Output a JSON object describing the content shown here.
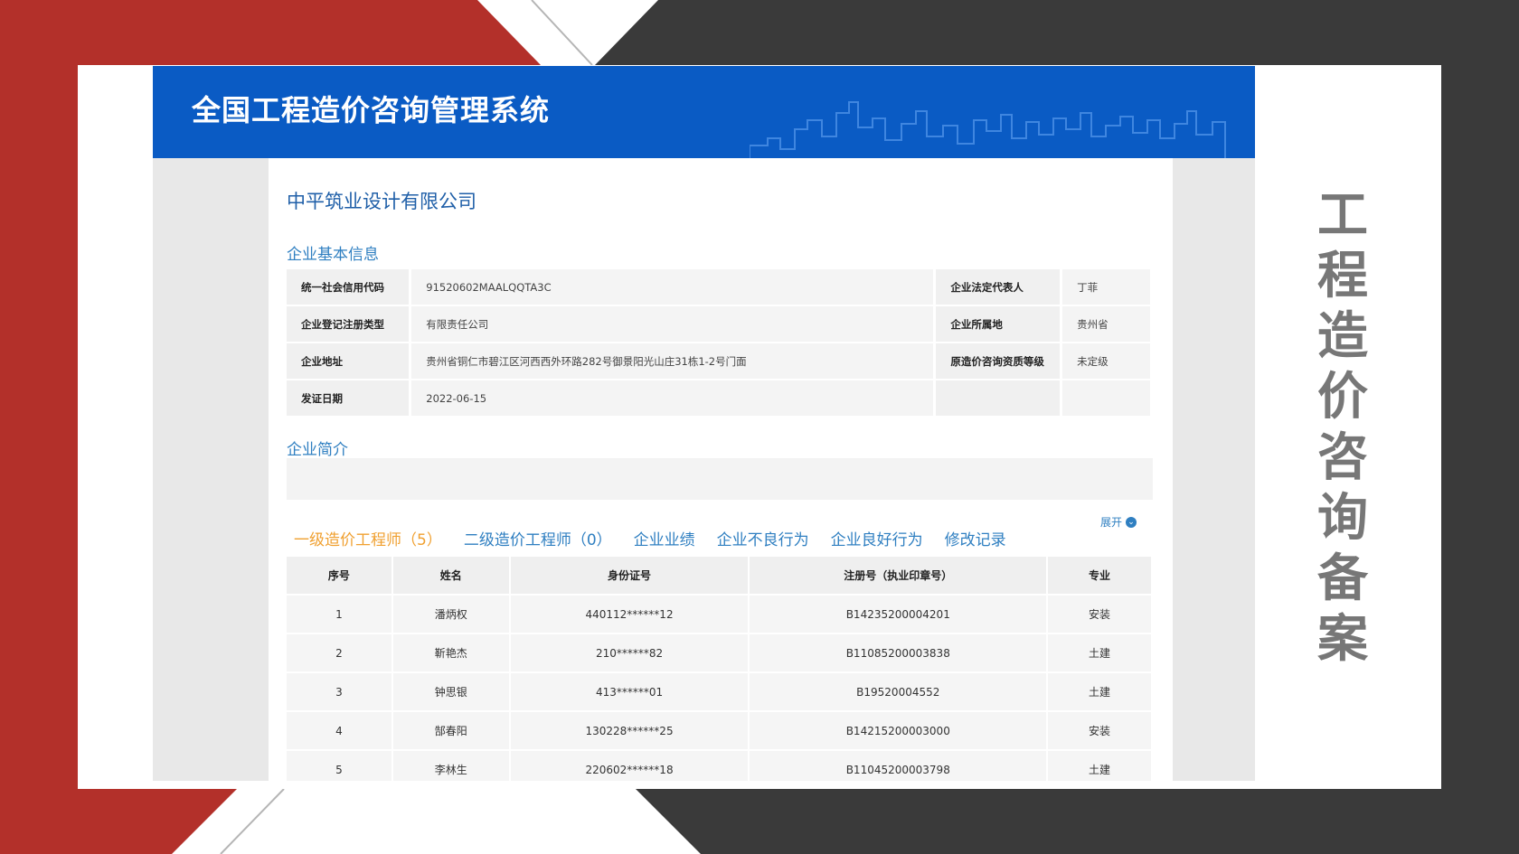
{
  "colors": {
    "red": "#b3302a",
    "dark": "#3a3a3a",
    "header_blue": "#0a5bc4",
    "link_blue": "#2f7fc1",
    "active_orange": "#f0a030",
    "vertical_title_gray": "#777777"
  },
  "header": {
    "system_title": "全国工程造价咨询管理系统"
  },
  "company": {
    "name": "中平筑业设计有限公司"
  },
  "sections": {
    "basic_info": "企业基本信息",
    "intro": "企业简介",
    "expand_label": "展开",
    "expand_icon": "chevron-down-circle-icon"
  },
  "basic_info": {
    "rows": [
      {
        "label1": "统一社会信用代码",
        "value1": "91520602MAALQQTA3C",
        "label2": "企业法定代表人",
        "value2": "丁菲"
      },
      {
        "label1": "企业登记注册类型",
        "value1": "有限责任公司",
        "label2": "企业所属地",
        "value2": "贵州省"
      },
      {
        "label1": "企业地址",
        "value1": "贵州省铜仁市碧江区河西西外环路282号御景阳光山庄31栋1-2号门面",
        "label2": "原造价咨询资质等级",
        "value2": "未定级"
      },
      {
        "label1": "发证日期",
        "value1": "2022-06-15",
        "label2": "",
        "value2": ""
      }
    ]
  },
  "tabs": [
    {
      "label": "一级造价工程师（5）",
      "active": true
    },
    {
      "label": "二级造价工程师（0）",
      "active": false
    },
    {
      "label": "企业业绩",
      "active": false
    },
    {
      "label": "企业不良行为",
      "active": false
    },
    {
      "label": "企业良好行为",
      "active": false
    },
    {
      "label": "修改记录",
      "active": false
    }
  ],
  "engineers": {
    "headers": [
      "序号",
      "姓名",
      "身份证号",
      "注册号（执业印章号）",
      "专业"
    ],
    "rows": [
      [
        "1",
        "潘炳权",
        "440112******12",
        "B14235200004201",
        "安装"
      ],
      [
        "2",
        "靳艳杰",
        "210******82",
        "B11085200003838",
        "土建"
      ],
      [
        "3",
        "钟思银",
        "413******01",
        "B19520004552",
        "土建"
      ],
      [
        "4",
        "郜春阳",
        "130228******25",
        "B14215200003000",
        "安装"
      ],
      [
        "5",
        "李林生",
        "220602******18",
        "B11045200003798",
        "土建"
      ]
    ]
  },
  "slide": {
    "vertical_title": [
      "工",
      "程",
      "造",
      "价",
      "咨",
      "询",
      "备",
      "案"
    ]
  }
}
